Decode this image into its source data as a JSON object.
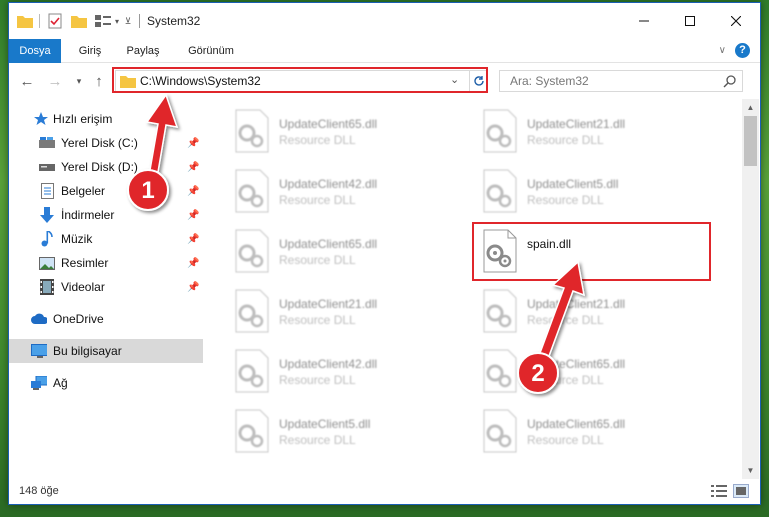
{
  "title": "System32",
  "ribbon": {
    "tabs": [
      "Dosya",
      "Giriş",
      "Paylaş",
      "Görünüm"
    ],
    "help": "?"
  },
  "address": {
    "path": "C:\\Windows\\System32"
  },
  "search": {
    "placeholder": "Ara: System32"
  },
  "sidebar": {
    "items": [
      {
        "label": "Hızlı erişim",
        "icon": "star-icon"
      },
      {
        "label": "Yerel Disk (C:)",
        "icon": "drive-c-icon",
        "pinned": true
      },
      {
        "label": "Yerel Disk (D:)",
        "icon": "drive-d-icon",
        "pinned": true
      },
      {
        "label": "Belgeler",
        "icon": "documents-icon",
        "pinned": true
      },
      {
        "label": "İndirmeler",
        "icon": "downloads-icon",
        "pinned": true
      },
      {
        "label": "Müzik",
        "icon": "music-icon",
        "pinned": true
      },
      {
        "label": "Resimler",
        "icon": "pictures-icon",
        "pinned": true
      },
      {
        "label": "Videolar",
        "icon": "videos-icon",
        "pinned": true
      },
      {
        "label": "OneDrive",
        "icon": "onedrive-icon"
      },
      {
        "label": "Bu bilgisayar",
        "icon": "computer-icon",
        "selected": true
      },
      {
        "label": "Ağ",
        "icon": "network-icon"
      }
    ]
  },
  "files": {
    "left": [
      {
        "name": "UpdateClient65.dll",
        "type": "Resource DLL"
      },
      {
        "name": "UpdateClient42.dll",
        "type": "Resource DLL"
      },
      {
        "name": "UpdateClient65.dll",
        "type": "Resource DLL"
      },
      {
        "name": "UpdateClient21.dll",
        "type": "Resource DLL"
      },
      {
        "name": "UpdateClient42.dll",
        "type": "Resource DLL"
      },
      {
        "name": "UpdateClient5.dll",
        "type": "Resource DLL"
      }
    ],
    "right": [
      {
        "name": "UpdateClient21.dll",
        "type": "Resource DLL"
      },
      {
        "name": "UpdateClient5.dll",
        "type": "Resource DLL"
      },
      {
        "name": "spain.dll",
        "type": "",
        "highlight": true
      },
      {
        "name": "UpdateClient21.dll",
        "type": "Resource DLL"
      },
      {
        "name": "UpdateClient65.dll",
        "type": "Resource DLL"
      },
      {
        "name": "UpdateClient65.dll",
        "type": "Resource DLL"
      }
    ]
  },
  "status": {
    "count": "148 öğe"
  },
  "annotations": {
    "step1": "1",
    "step2": "2",
    "color": "#e0262b"
  }
}
